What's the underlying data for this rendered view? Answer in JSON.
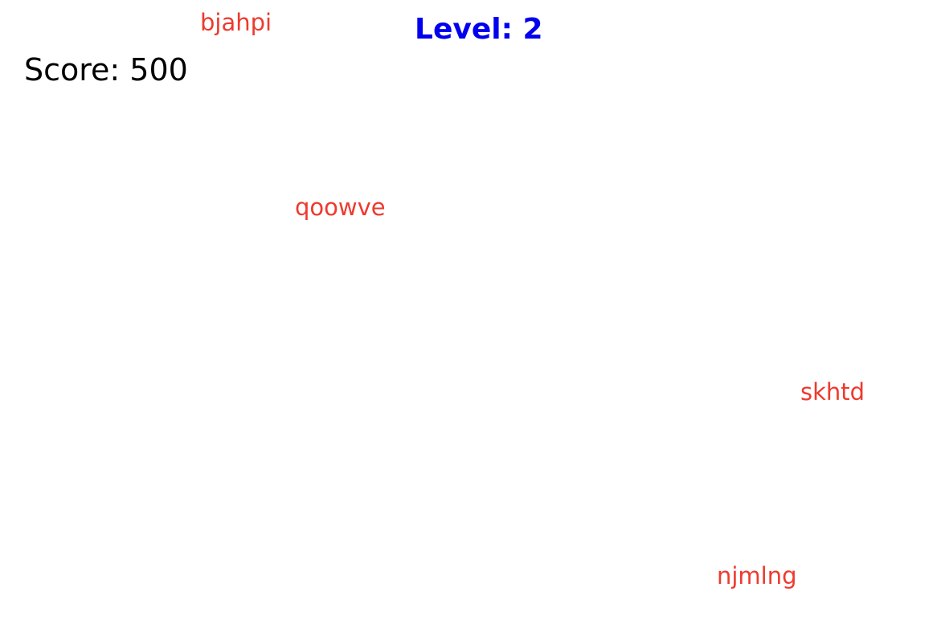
{
  "hud": {
    "score_label": "Score: 500",
    "level_label": "Level: 2"
  },
  "words": [
    {
      "text": "bjahpi"
    },
    {
      "text": "qoowve"
    },
    {
      "text": "skhtd"
    },
    {
      "text": "njmlng"
    }
  ],
  "colors": {
    "background": "#ffffff",
    "score_text": "#000000",
    "level_text": "#0000ee",
    "word_text": "#ee3a2e"
  }
}
